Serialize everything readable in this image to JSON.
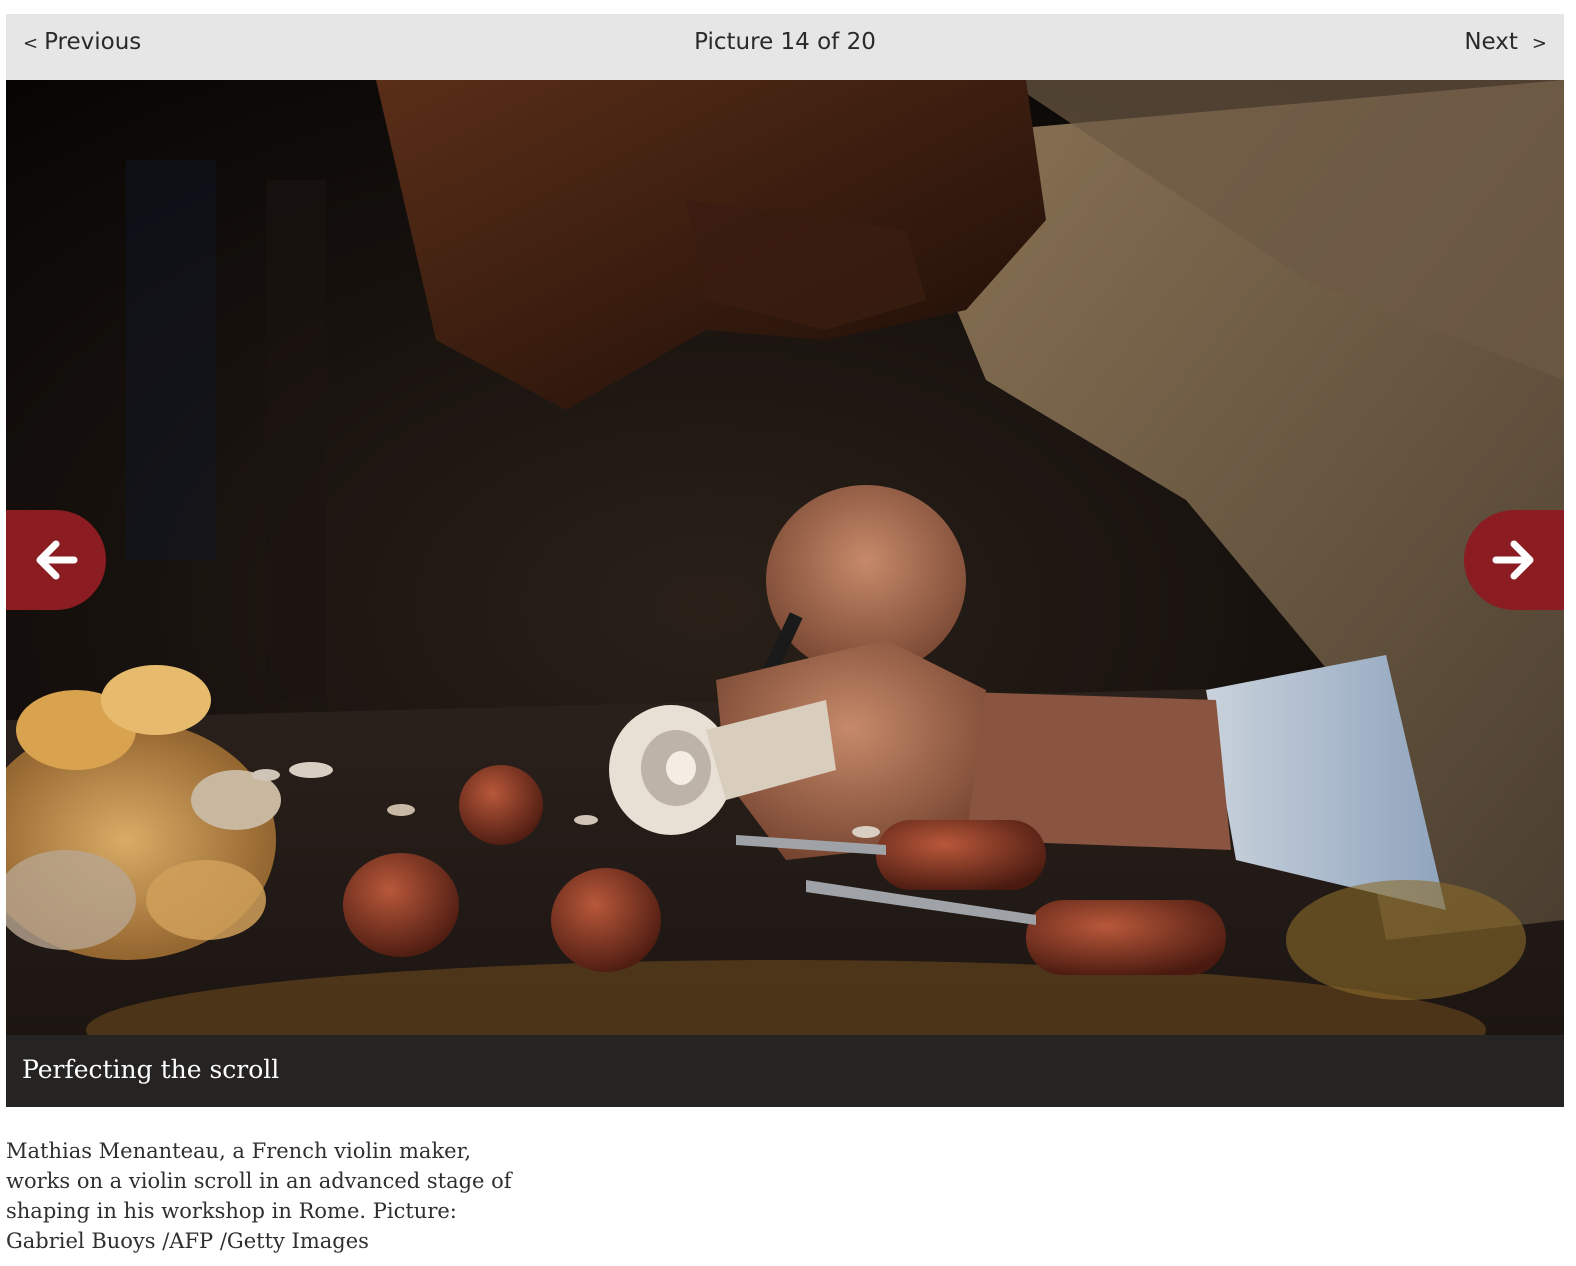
{
  "navigation": {
    "previous_symbol": "<",
    "previous_label": "Previous",
    "counter": "Picture 14 of 20",
    "next_label": "Next",
    "next_symbol": ">"
  },
  "photo": {
    "subject": "violin maker carving a violin scroll at a workbench"
  },
  "caption": {
    "title": "Perfecting the scroll",
    "description": "Mathias Menanteau, a French violin maker, works on a violin scroll in an advanced stage of shaping in his workshop in Rome. Picture: Gabriel Buoys /AFP /Getty Images"
  },
  "colors": {
    "nav_background": "#e6e6e6",
    "arrow_button": "#8a1c22",
    "caption_background": "#262422"
  }
}
